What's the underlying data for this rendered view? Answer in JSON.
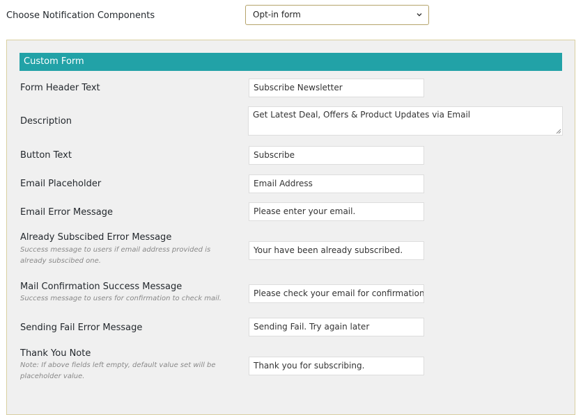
{
  "top": {
    "label": "Choose Notification Components",
    "select_value": "Opt-in form"
  },
  "panel": {
    "header": "Custom Form",
    "fields": [
      {
        "label": "Form Header Text",
        "value": "Subscribe Newsletter"
      },
      {
        "label": "Description",
        "value": "Get Latest Deal, Offers & Product Updates via Email"
      },
      {
        "label": "Button Text",
        "value": "Subscribe"
      },
      {
        "label": "Email Placeholder",
        "value": "Email Address"
      },
      {
        "label": "Email Error Message",
        "value": "Please enter your email."
      },
      {
        "label": "Already Subscibed Error Message",
        "desc": "Success message to users if email address provided is already subscibed one.",
        "value": "Your have been already subscribed."
      },
      {
        "label": "Mail Confirmation Success Message",
        "desc": "Success message to users for confirmation to check mail.",
        "value": "Please check your email for confirmation."
      },
      {
        "label": "Sending Fail Error Message",
        "value": "Sending Fail. Try again later"
      },
      {
        "label": "Thank You Note",
        "desc": "Note: If above fields left empty, default value set will be placeholder value.",
        "value": "Thank you for subscribing."
      }
    ]
  }
}
